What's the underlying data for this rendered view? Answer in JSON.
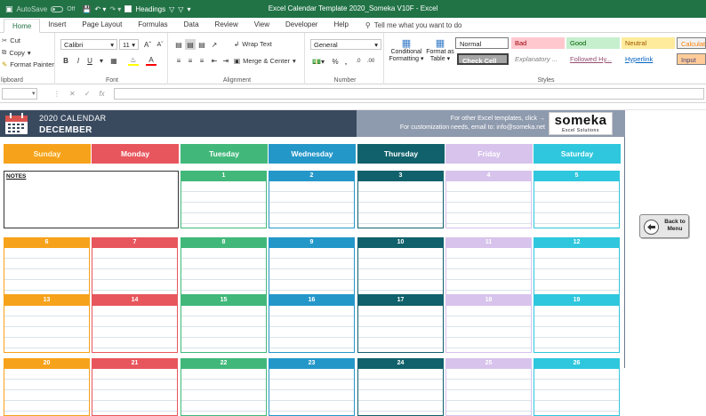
{
  "titlebar": {
    "autosave_label": "AutoSave",
    "autosave_state": "Off",
    "headings_label": "Headings",
    "title": "Excel Calendar Template 2020_Someka V10F  -  Excel"
  },
  "tabs": [
    "Home",
    "Insert",
    "Page Layout",
    "Formulas",
    "Data",
    "Review",
    "View",
    "Developer",
    "Help"
  ],
  "tellme": "Tell me what you want to do",
  "ribbon": {
    "clipboard": {
      "cut": "Cut",
      "copy": "Copy",
      "format_painter": "Format Painter",
      "label": "lipboard"
    },
    "font": {
      "name": "Calibri",
      "size": "11",
      "label": "Font"
    },
    "alignment": {
      "wrap": "Wrap Text",
      "merge": "Merge & Center",
      "label": "Alignment"
    },
    "number": {
      "format": "General",
      "label": "Number"
    },
    "styles": {
      "conditional": [
        "Conditional",
        "Formatting"
      ],
      "format_table": [
        "Format as",
        "Table"
      ],
      "cells": [
        {
          "text": "Normal",
          "bg": "#ffffff",
          "fg": "#000000"
        },
        {
          "text": "Bad",
          "bg": "#ffc7ce",
          "fg": "#9c0006"
        },
        {
          "text": "Good",
          "bg": "#c6efce",
          "fg": "#006100"
        },
        {
          "text": "Neutral",
          "bg": "#ffeb9c",
          "fg": "#9c5700"
        },
        {
          "text": "Calculatio",
          "bg": "#f2f2f2",
          "fg": "#fa7d00"
        },
        {
          "text": "Check Cell",
          "bg": "#a5a5a5",
          "fg": "#ffffff"
        },
        {
          "text": "Explanatory ...",
          "bg": "#ffffff",
          "fg": "#7f7f7f"
        },
        {
          "text": "Followed Hy...",
          "bg": "#ffffff",
          "fg": "#954f72"
        },
        {
          "text": "Hyperlink",
          "bg": "#ffffff",
          "fg": "#0563c1"
        },
        {
          "text": "Input",
          "bg": "#ffcc99",
          "fg": "#3f3f76"
        }
      ],
      "label": "Styles"
    }
  },
  "calendar": {
    "year_title": "2020 CALENDAR",
    "month": "DECEMBER",
    "promo_line1": "For other Excel templates, click →",
    "promo_line2": "For customization needs, email to: info@someka.net",
    "logo_name": "someka",
    "logo_sub": "Excel Solutions",
    "notes_label": "NOTES",
    "weekdays": [
      {
        "name": "Sunday",
        "color": "#f7a21b",
        "text": "#fff5d6"
      },
      {
        "name": "Monday",
        "color": "#e8565d",
        "text": "#ffffff"
      },
      {
        "name": "Tuesday",
        "color": "#41b87a",
        "text": "#ffffff"
      },
      {
        "name": "Wednesday",
        "color": "#2497c9",
        "text": "#ffffff"
      },
      {
        "name": "Thursday",
        "color": "#10616b",
        "text": "#ffffff"
      },
      {
        "name": "Friday",
        "color": "#d7c3ec",
        "text": "#ffffff"
      },
      {
        "name": "Saturday",
        "color": "#2fc7dd",
        "text": "#ffffff"
      }
    ],
    "weeks": [
      [
        "",
        "",
        "1",
        "2",
        "3",
        "4",
        "5"
      ],
      [
        "6",
        "7",
        "8",
        "9",
        "10",
        "11",
        "12"
      ],
      [
        "13",
        "14",
        "15",
        "16",
        "17",
        "18",
        "19"
      ],
      [
        "20",
        "21",
        "22",
        "23",
        "24",
        "25",
        "26"
      ]
    ]
  },
  "back_button": [
    "Back to",
    "Menu"
  ]
}
